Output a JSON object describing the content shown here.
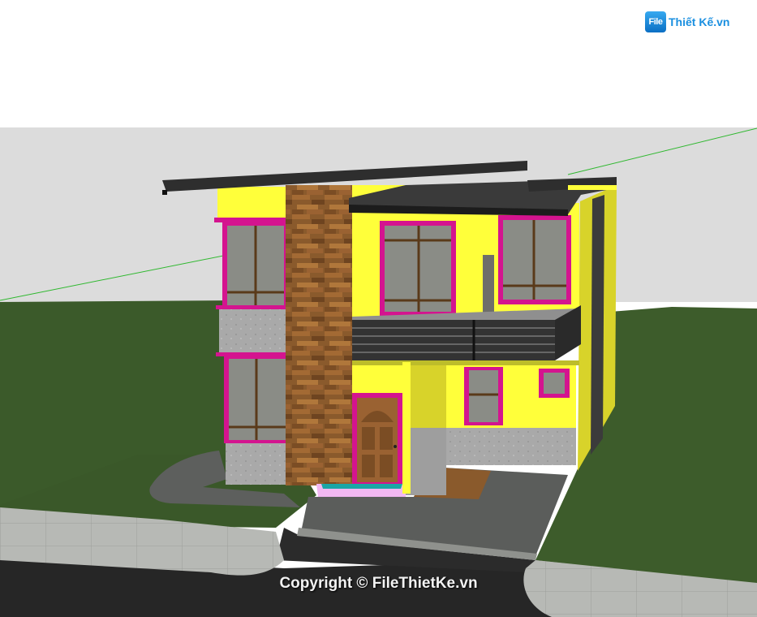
{
  "logo": {
    "badge": "File",
    "text": "Thiết Kế.vn"
  },
  "copyright": "Copyright © FileThietKe.vn",
  "colors": {
    "sky": "#ffffff",
    "horizon_band": "#dcdcdc",
    "lawn": "#3b5a2a",
    "road": "#262626",
    "sidewalk": "#b9bbb7",
    "driveway": "#5b5d5b",
    "wall_yellow": "#ffff3a",
    "window_frame": "#d4148f",
    "wood_cladding": "#8a5a2c",
    "roof": "#2e2e2e",
    "base_stone": "#a8a8a8"
  }
}
